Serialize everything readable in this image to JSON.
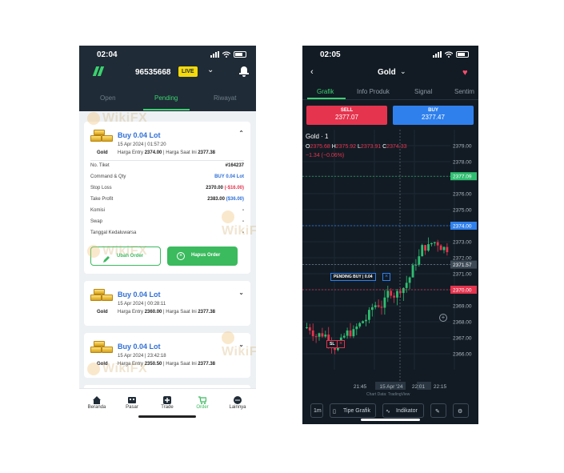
{
  "left": {
    "status_time": "02:04",
    "account_number": "96535668",
    "live_badge": "LIVE",
    "tabs": [
      "Open",
      "Pending",
      "Riwayat"
    ],
    "orders": [
      {
        "title": "Buy 0.04 Lot",
        "date": "15 Apr 2024 | 01:57:20",
        "entry_label": "Harga Entry",
        "entry": "2374.00",
        "current_label": "Harga Saat Ini",
        "current": "2377.38",
        "asset": "Gold",
        "details": [
          {
            "label": "No. Tiket",
            "value": "#164237"
          },
          {
            "label": "Command & Qty",
            "value": "BUY 0.04 Lot"
          },
          {
            "label": "Stop Loss",
            "value": "2370.00",
            "extra": "(-$16.00)"
          },
          {
            "label": "Take Profit",
            "value": "2383.00",
            "extra": "($36.00)"
          },
          {
            "label": "Komisi",
            "value": "-"
          },
          {
            "label": "Swap",
            "value": "-"
          },
          {
            "label": "Tanggal Kedaluwarsa",
            "value": "-"
          }
        ],
        "edit_label": "Ubah Order",
        "delete_label": "Hapus Order"
      },
      {
        "title": "Buy 0.04 Lot",
        "date": "15 Apr 2024 | 00:28:11",
        "entry_label": "Harga Entry",
        "entry": "2360.00",
        "current_label": "Harga Saat Ini",
        "current": "2377.38",
        "asset": "Gold"
      },
      {
        "title": "Buy 0.04 Lot",
        "date": "15 Apr 2024 | 23:42:18",
        "entry_label": "Harga Entry",
        "entry": "2350.50",
        "current_label": "Harga Saat Ini",
        "current": "2377.38",
        "asset": "Gold"
      }
    ],
    "nav": [
      "Beranda",
      "Pasar",
      "Trade",
      "Order",
      "Lainnya"
    ],
    "watermark": "WikiFX"
  },
  "right": {
    "status_time": "02:05",
    "symbol": "Gold",
    "tabs": [
      "Grafik",
      "Info Produk",
      "Signal",
      "Sentim"
    ],
    "sell_label": "SELL",
    "sell_price": "2377.07",
    "buy_label": "BUY",
    "buy_price": "2377.47",
    "chart_title": "Gold · 1",
    "ohlc": {
      "o": "2375.68",
      "h": "2375.92",
      "l": "2373.91",
      "c": "2374.33"
    },
    "change": "−1.34 (−0.06%)",
    "price_axis": [
      "2379.00",
      "2378.00",
      "2377.09",
      "2376.00",
      "2375.00",
      "2374.00",
      "2373.00",
      "2372.00",
      "2371.57",
      "2371.00",
      "2370.00",
      "2369.00",
      "2368.00",
      "2367.00",
      "2366.00"
    ],
    "time_axis": [
      "21:45",
      "15 Apr '24",
      "22:01",
      "22:15"
    ],
    "pending_label": "PENDING BUY | 0.04",
    "sl_label": "SL",
    "tv_label": "Chart Data: TradingView",
    "toolbar": {
      "interval": "1m",
      "chart_type": "Tipe Grafik",
      "indicator": "Indikator"
    },
    "colors": {
      "up": "#2fbf71",
      "down": "#e5344e",
      "pending": "#2f80ed",
      "current": "#2fbf71"
    }
  }
}
